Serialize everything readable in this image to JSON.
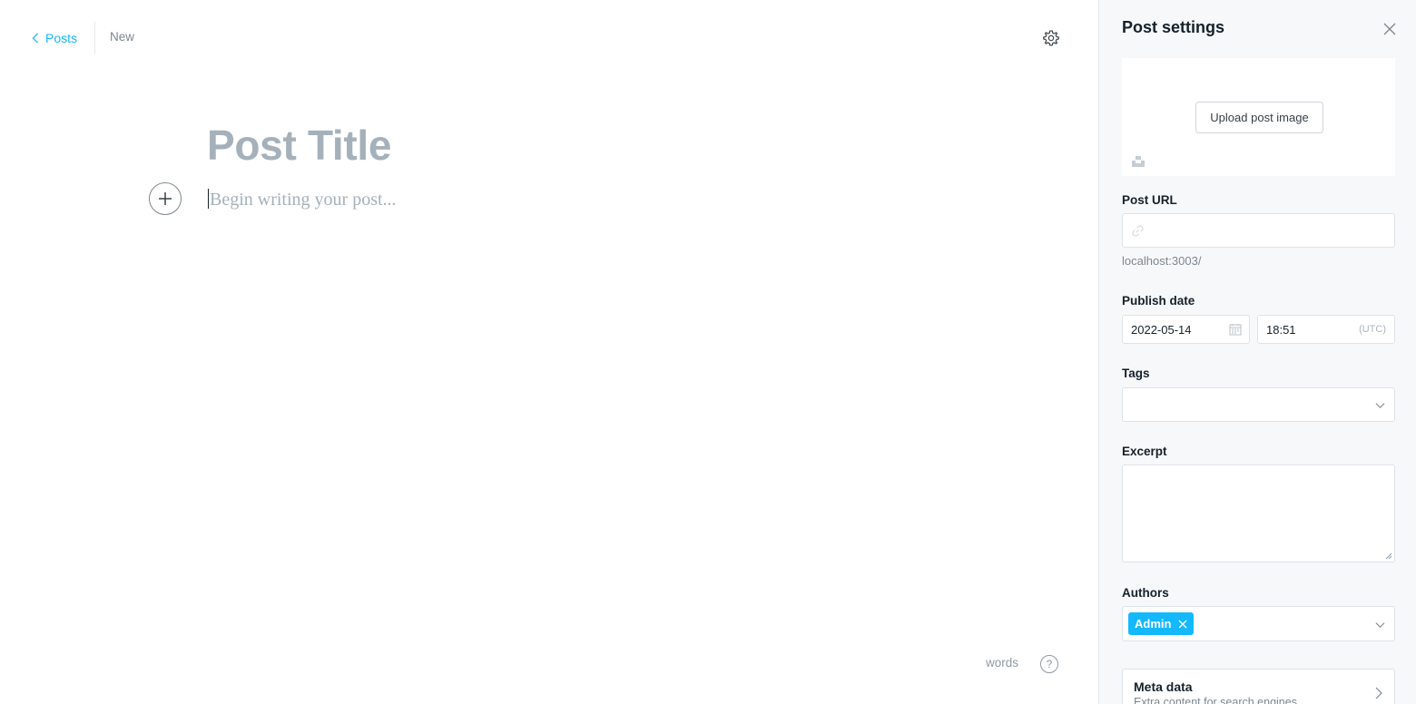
{
  "header": {
    "back_label": "Posts",
    "status_label": "New"
  },
  "editor": {
    "title_placeholder": "Post Title",
    "body_placeholder": "Begin writing your post...",
    "word_count_label": "words",
    "help_label": "?"
  },
  "settings": {
    "title": "Post settings",
    "upload_label": "Upload post image",
    "post_url": {
      "label": "Post URL",
      "value": "",
      "hint": "localhost:3003/"
    },
    "publish_date": {
      "label": "Publish date",
      "date": "2022-05-14",
      "time": "18:51",
      "timezone": "(UTC)"
    },
    "tags": {
      "label": "Tags",
      "value": ""
    },
    "excerpt": {
      "label": "Excerpt",
      "value": ""
    },
    "authors": {
      "label": "Authors",
      "selected": [
        "Admin"
      ]
    },
    "meta_data": {
      "title": "Meta data",
      "subtitle": "Extra content for search engines"
    }
  },
  "colors": {
    "accent": "#14b8ff",
    "placeholder": "#a5b1ba",
    "panel_bg": "#f7f8fa"
  }
}
